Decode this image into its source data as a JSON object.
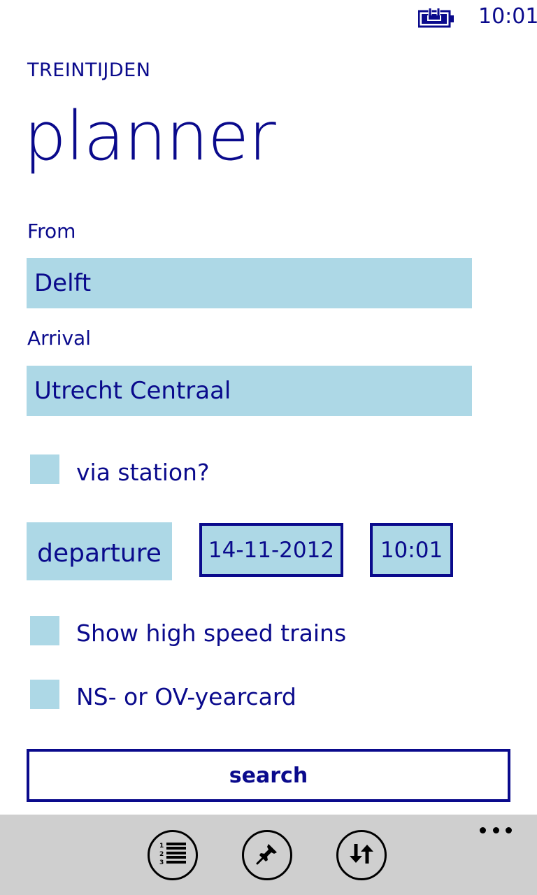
{
  "status_bar": {
    "time": "10:01",
    "battery_icon": "battery-charging-icon"
  },
  "header": {
    "app_title": "TREINTIJDEN",
    "page_title": "planner"
  },
  "form": {
    "from_label": "From",
    "from_value": "Delft",
    "arrival_label": "Arrival",
    "arrival_value": "Utrecht Centraal",
    "via_label": "via station?",
    "via_checked": false,
    "departure_label": "departure",
    "date_value": "14-11-2012",
    "time_value": "10:01",
    "highspeed_label": "Show high speed trains",
    "highspeed_checked": false,
    "yearcard_label": "NS- or OV-yearcard",
    "yearcard_checked": false,
    "search_label": "search"
  },
  "app_bar": {
    "buttons": [
      {
        "icon": "numbered-list-icon"
      },
      {
        "icon": "pin-icon"
      },
      {
        "icon": "swap-arrows-icon"
      }
    ],
    "more_icon": "ellipsis-icon"
  },
  "colors": {
    "accent": "#0a0a8c",
    "field_background": "#add8e6",
    "app_bar_background": "#cfcfcf",
    "page_background": "#ffffff"
  }
}
